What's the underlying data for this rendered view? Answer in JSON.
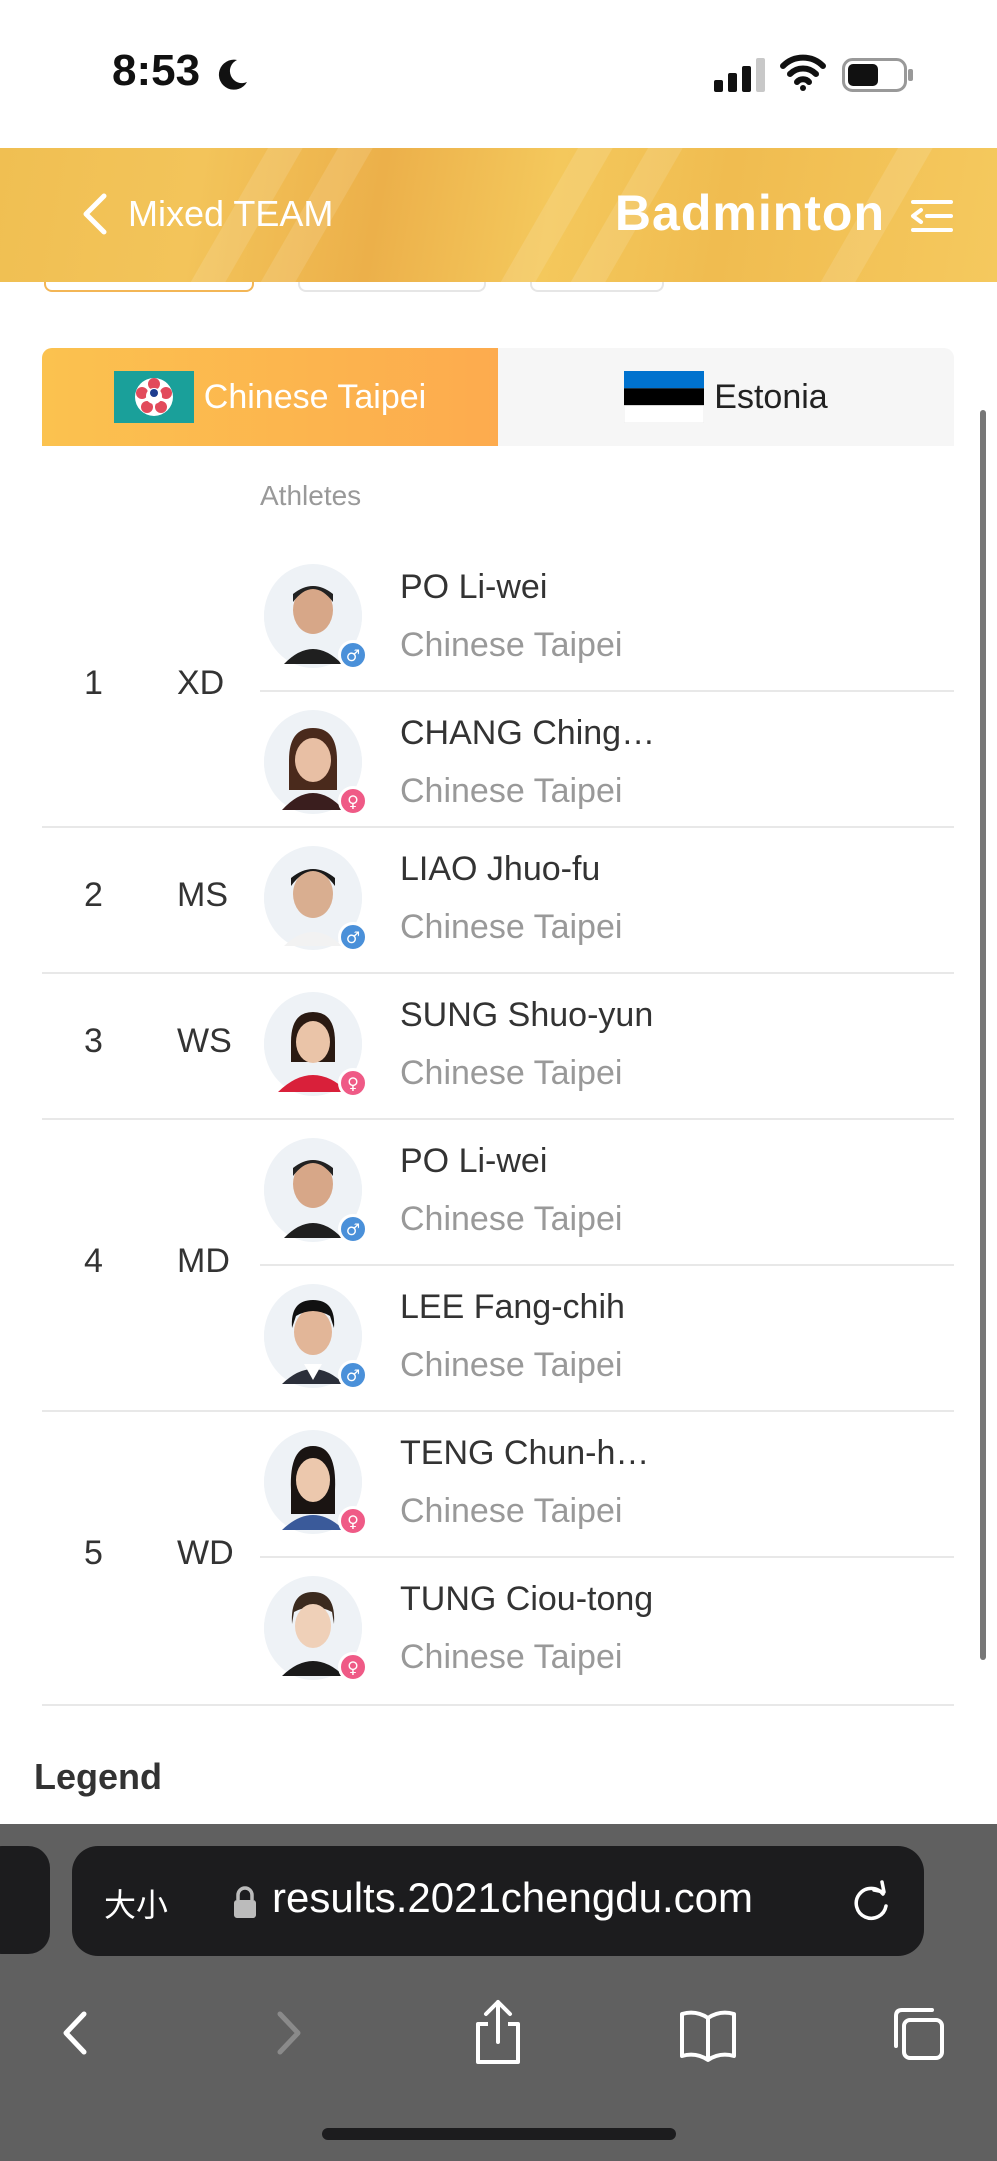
{
  "status": {
    "time": "8:53"
  },
  "header": {
    "back_label": "Mixed TEAM",
    "sport": "Badminton"
  },
  "teams": [
    {
      "name": "Chinese Taipei",
      "active": true
    },
    {
      "name": "Estonia",
      "active": false
    }
  ],
  "card": {
    "athletes_heading": "Athletes"
  },
  "matches": [
    {
      "no": "1",
      "type": "XD",
      "athletes": [
        {
          "name": "PO Li-wei",
          "team": "Chinese Taipei",
          "gender": "♂"
        },
        {
          "name": "CHANG Ching…",
          "team": "Chinese Taipei",
          "gender": "♀"
        }
      ]
    },
    {
      "no": "2",
      "type": "MS",
      "athletes": [
        {
          "name": "LIAO Jhuo-fu",
          "team": "Chinese Taipei",
          "gender": "♂"
        }
      ]
    },
    {
      "no": "3",
      "type": "WS",
      "athletes": [
        {
          "name": "SUNG Shuo-yun",
          "team": "Chinese Taipei",
          "gender": "♀"
        }
      ]
    },
    {
      "no": "4",
      "type": "MD",
      "athletes": [
        {
          "name": "PO Li-wei",
          "team": "Chinese Taipei",
          "gender": "♂"
        },
        {
          "name": "LEE Fang-chih",
          "team": "Chinese Taipei",
          "gender": "♂"
        }
      ]
    },
    {
      "no": "5",
      "type": "WD",
      "athletes": [
        {
          "name": "TENG Chun-h…",
          "team": "Chinese Taipei",
          "gender": "♀"
        },
        {
          "name": "TUNG Ciou-tong",
          "team": "Chinese Taipei",
          "gender": "♀"
        }
      ]
    }
  ],
  "legend": "Legend",
  "browser": {
    "text_size_label": "大小",
    "url": "results.2021chengdu.com"
  },
  "colors": {
    "accent": "#fbc24f",
    "male": "#4a90d9",
    "female": "#ef5a86"
  }
}
